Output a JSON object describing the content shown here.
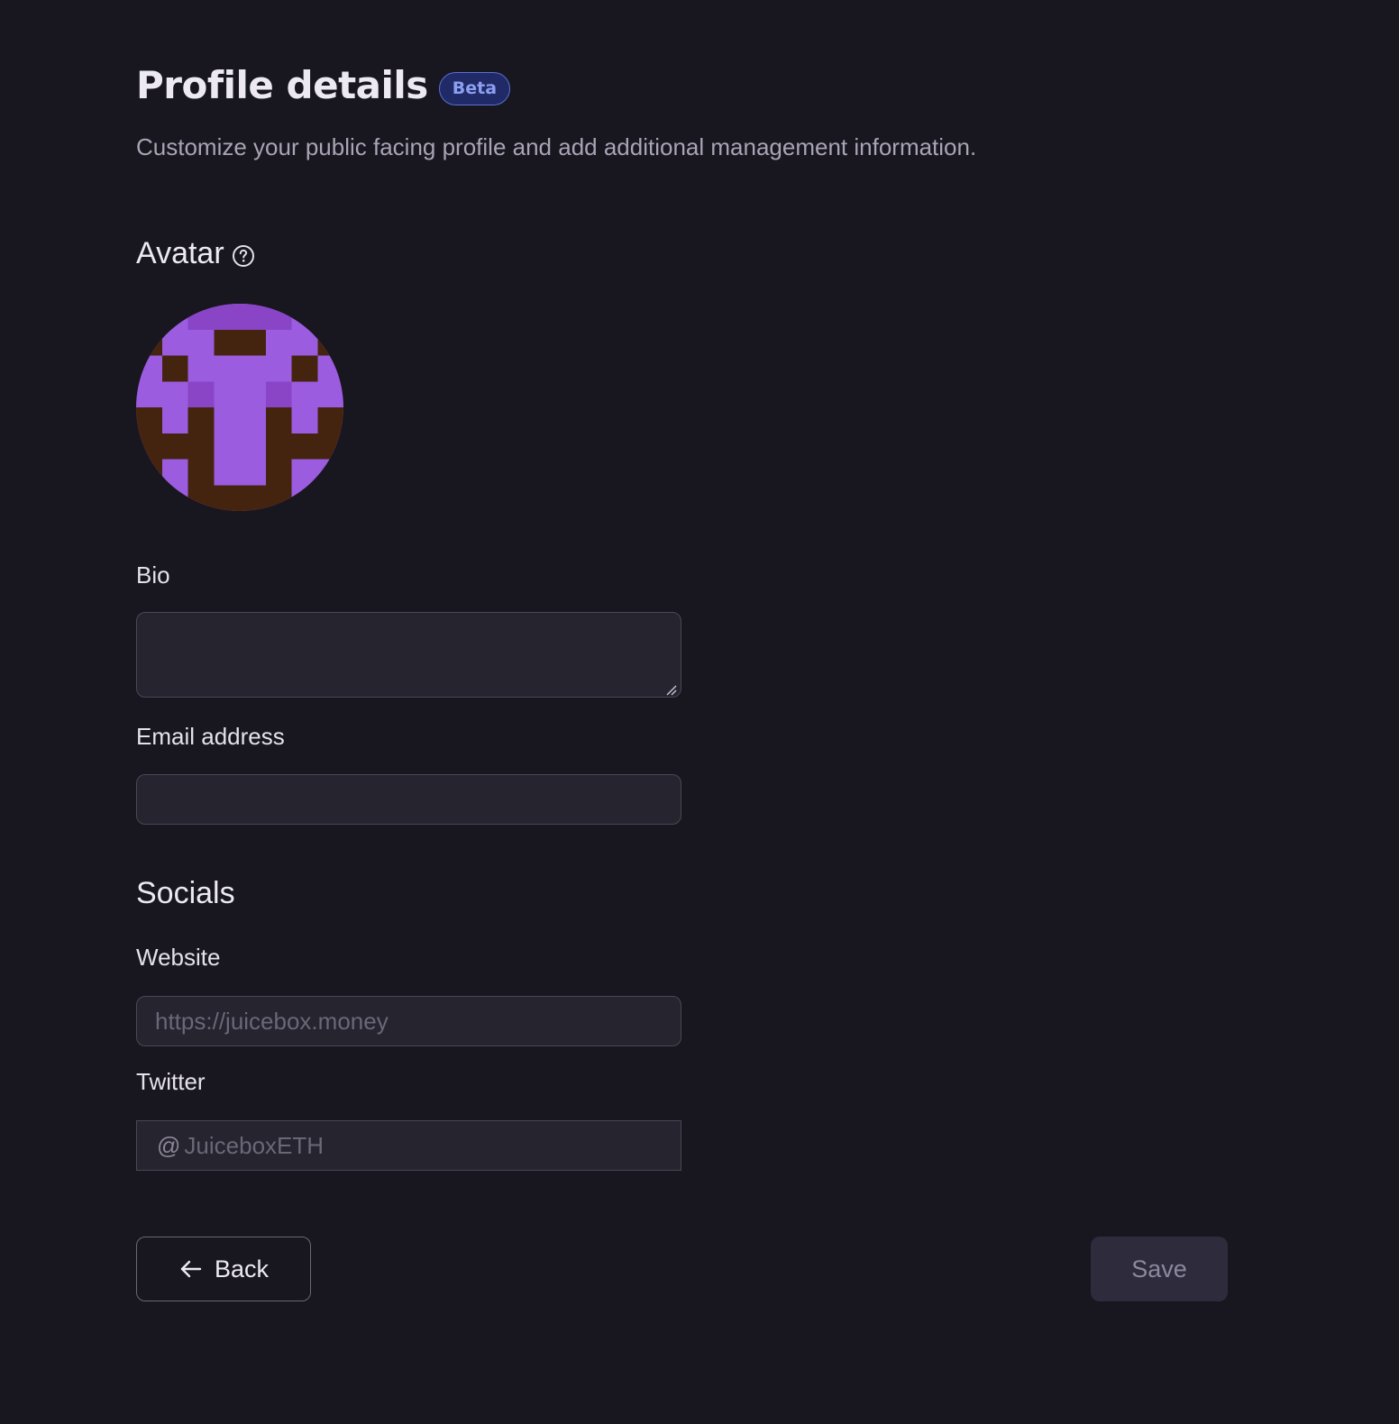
{
  "header": {
    "title": "Profile details",
    "badge": "Beta",
    "subtitle": "Customize your public facing profile and add additional management information."
  },
  "avatar_section": {
    "heading": "Avatar",
    "help_icon": "question-circle-icon",
    "avatar_colors": {
      "primary": "#9b5cdf",
      "accent": "#8a45c7",
      "dark": "#45240f"
    }
  },
  "form": {
    "bio": {
      "label": "Bio",
      "value": ""
    },
    "email": {
      "label": "Email address",
      "value": "",
      "placeholder": ""
    }
  },
  "socials": {
    "heading": "Socials",
    "website": {
      "label": "Website",
      "value": "",
      "placeholder": "https://juicebox.money"
    },
    "twitter": {
      "label": "Twitter",
      "prefix": "@",
      "value": "",
      "placeholder": "JuiceboxETH"
    }
  },
  "actions": {
    "back_label": "Back",
    "back_icon": "arrow-left-icon",
    "save_label": "Save"
  },
  "colors": {
    "background": "#18161e",
    "input_background": "#26242f",
    "badge_background": "#1f2a66",
    "badge_text": "#8c9ff0"
  }
}
